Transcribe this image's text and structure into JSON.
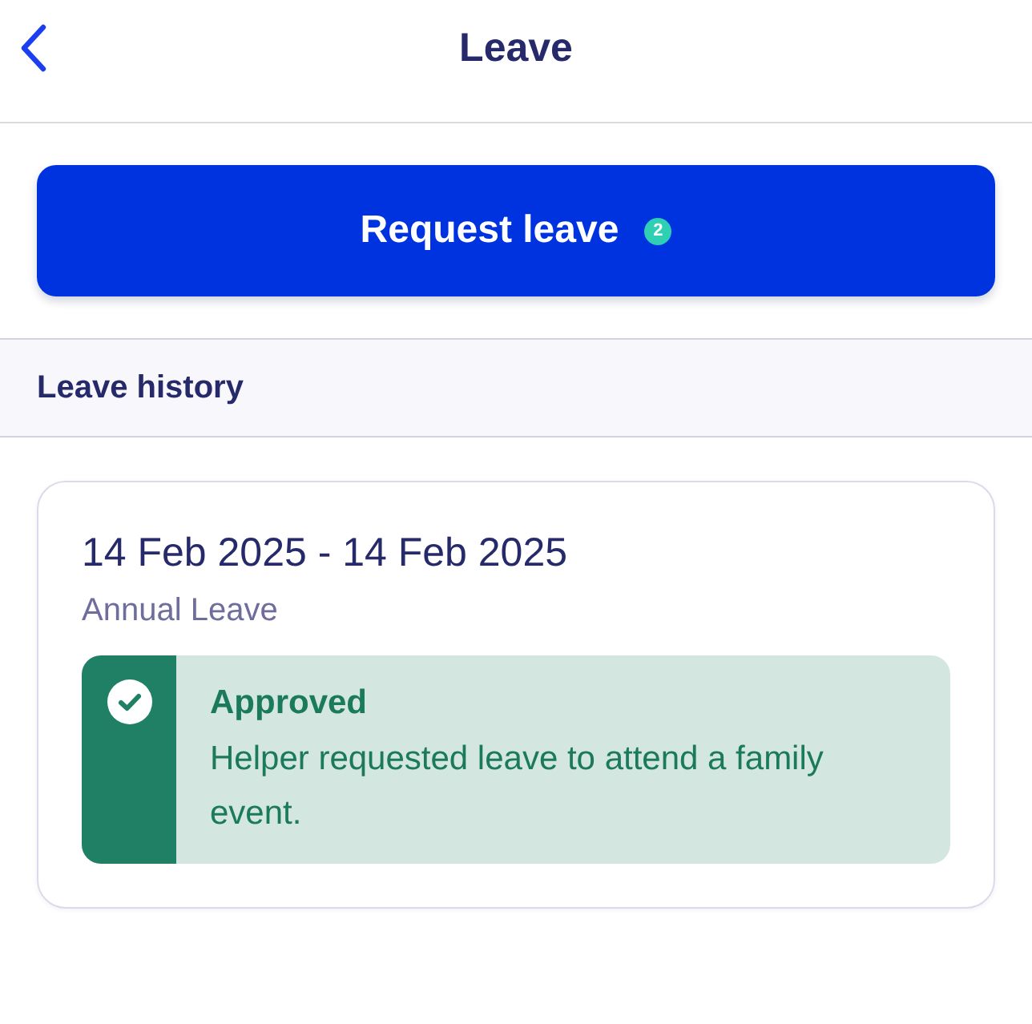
{
  "header": {
    "title": "Leave"
  },
  "request_button": {
    "label": "Request leave",
    "badge": "2"
  },
  "section": {
    "title": "Leave history"
  },
  "leave_history": [
    {
      "dates": "14 Feb 2025 - 14 Feb 2025",
      "type": "Annual Leave",
      "status": {
        "kind": "approved",
        "label": "Approved",
        "message": "Helper requested leave to attend a family event."
      }
    }
  ]
}
